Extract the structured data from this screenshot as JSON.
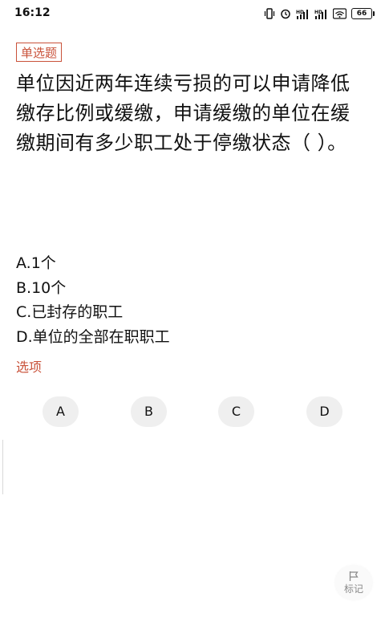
{
  "status_bar": {
    "time": "16:12",
    "icons": [
      "vibrate-icon",
      "alarm-icon",
      "signal-icon",
      "signal-icon",
      "wifi-icon",
      "battery-icon"
    ],
    "battery_level": "66"
  },
  "question": {
    "type_label": "单选题",
    "text": "单位因近两年连续亏损的可以申请降低缴存比例或缓缴，申请缓缴的单位在缓缴期间有多少职工处于停缴状态（ ）。",
    "options": [
      "A.1个",
      "B.10个",
      "C.已封存的职工",
      "D.单位的全部在职职工"
    ]
  },
  "choices": {
    "label": "选项",
    "buttons": [
      "A",
      "B",
      "C",
      "D"
    ]
  },
  "mark": {
    "label": "标记",
    "icon": "flag-icon"
  },
  "colors": {
    "accent": "#c9523a",
    "button_bg": "#efefef",
    "text": "#111111"
  }
}
